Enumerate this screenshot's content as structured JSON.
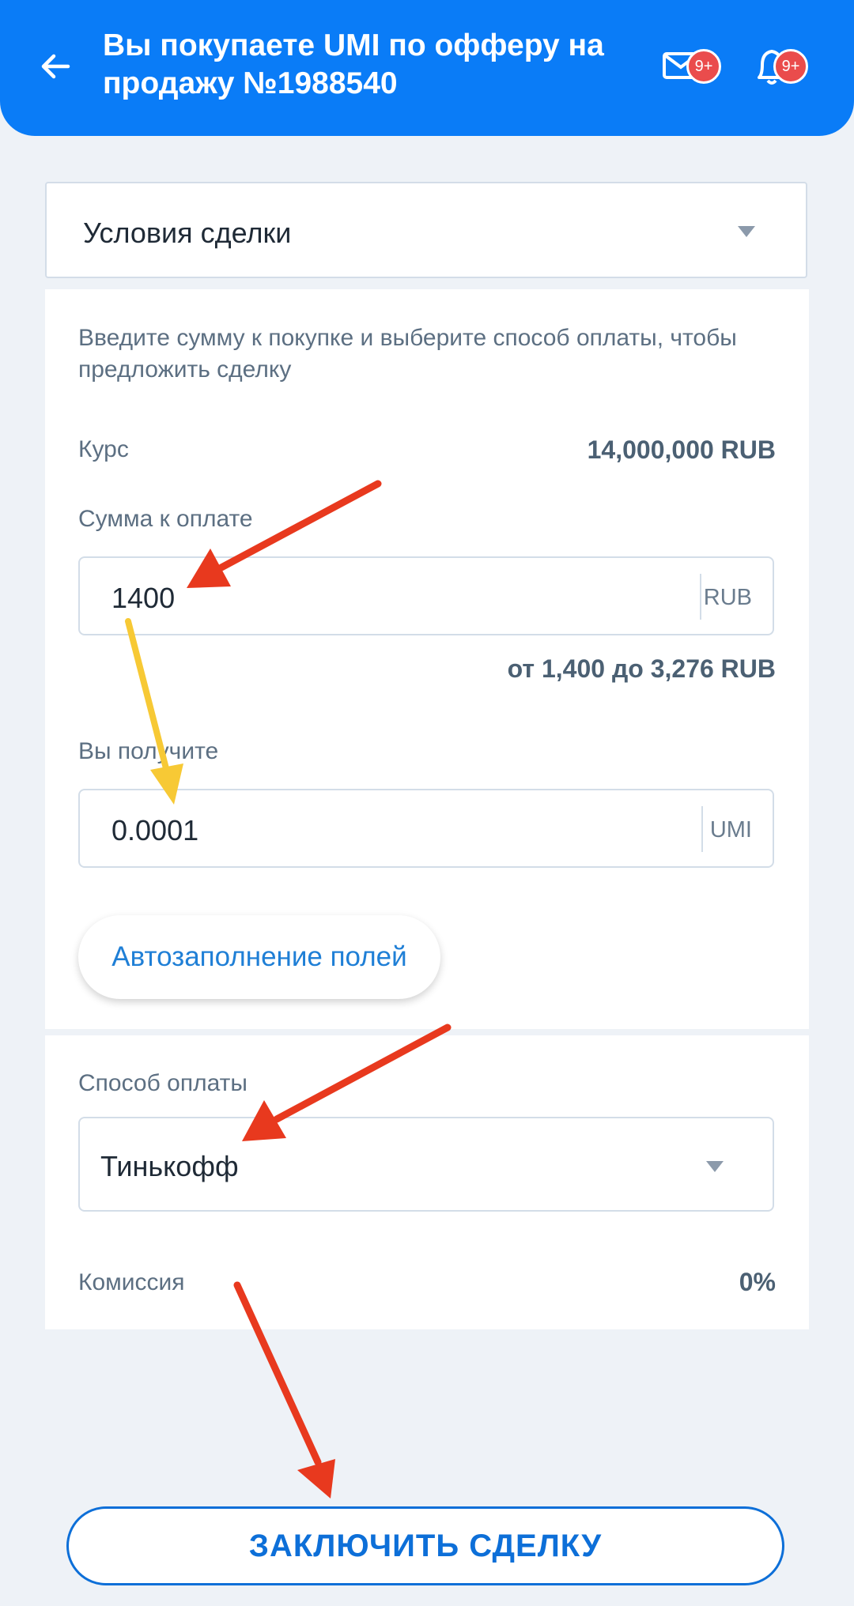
{
  "header": {
    "title": "Вы покупаете UMI по офферу на продажу №1988540",
    "mail_badge": "9+",
    "bell_badge": "9+"
  },
  "accordion": {
    "label": "Условия сделки"
  },
  "form": {
    "hint": "Введите сумму к покупке и выберите способ оплаты, чтобы предложить сделку",
    "rate_label": "Курс",
    "rate_value": "14,000,000 RUB",
    "pay_label": "Сумма к оплате",
    "pay_value": "1400",
    "pay_unit": "RUB",
    "range_text": "от 1,400 до 3,276 RUB",
    "receive_label": "Вы получите",
    "receive_value": "0.0001",
    "receive_unit": "UMI",
    "autofill_label": "Автозаполнение полей"
  },
  "payment": {
    "method_label": "Способ оплаты",
    "method_value": "Тинькофф",
    "commission_label": "Комиссия",
    "commission_value": "0%"
  },
  "deal_button": "ЗАКЛЮЧИТЬ СДЕЛКУ",
  "colors": {
    "header_bg": "#0a7cf7",
    "accent": "#0d6fd8",
    "badge": "#ea4c4c",
    "annotation_red": "#e8391e",
    "annotation_yellow": "#f7c935"
  },
  "icons": [
    "back-arrow-icon",
    "mail-icon",
    "bell-icon",
    "chevron-down-icon"
  ]
}
